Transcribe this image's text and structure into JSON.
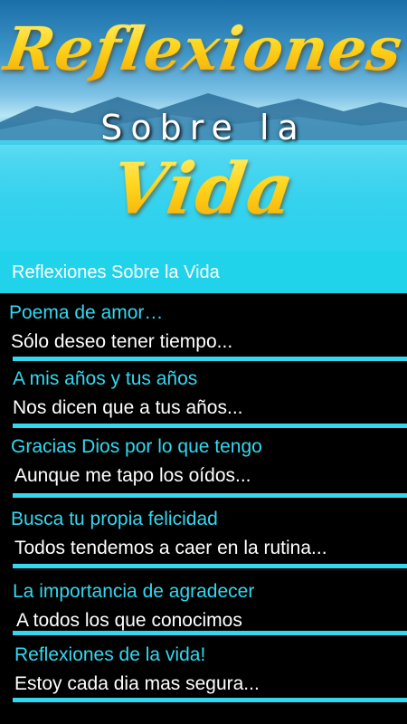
{
  "banner": {
    "line1": "Reflexiones",
    "line2": "Sobre la",
    "line3": "Vida"
  },
  "app_bar": {
    "title": "Reflexiones Sobre la Vida"
  },
  "items": [
    {
      "title": "Poema de amor…",
      "snippet": "Sólo deseo tener tiempo..."
    },
    {
      "title": "A mis años y tus años",
      "snippet": "Nos dicen que a tus años..."
    },
    {
      "title": "Gracias Dios por lo que tengo",
      "snippet": "Aunque me tapo los oídos..."
    },
    {
      "title": "Busca tu propia felicidad",
      "snippet": "Todos tendemos a caer en la rutina..."
    },
    {
      "title": "La importancia de agradecer",
      "snippet": "A todos los que conocimos"
    },
    {
      "title": "Reflexiones de la vida!",
      "snippet": "Estoy cada dia mas segura..."
    }
  ],
  "colors": {
    "accent": "#21d3ea",
    "item_title": "#33d8f0",
    "item_text": "#ffffff",
    "background": "#000000",
    "title_gold": "#ffd21a"
  }
}
